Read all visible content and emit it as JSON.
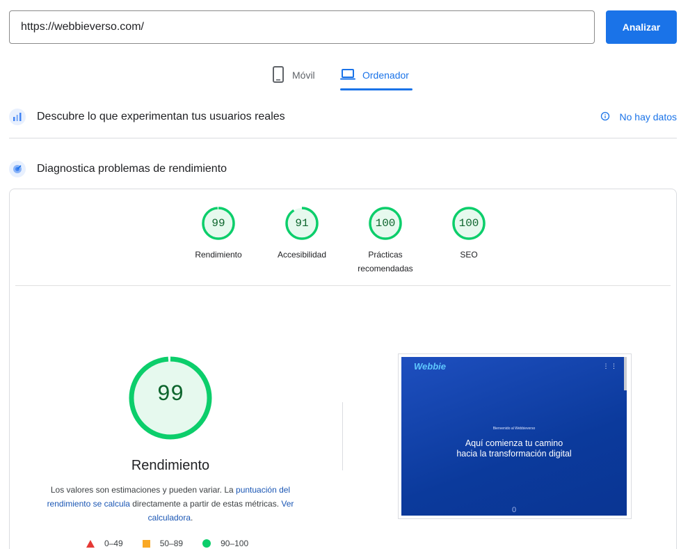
{
  "search": {
    "url_value": "https://webbieverso.com/",
    "analyze_label": "Analizar"
  },
  "tabs": {
    "mobile_label": "Móvil",
    "desktop_label": "Ordenador",
    "active": "desktop"
  },
  "field_data": {
    "title": "Descubre lo que experimentan tus usuarios reales",
    "no_data_label": "No hay datos"
  },
  "diagnostics": {
    "title": "Diagnostica problemas de rendimiento"
  },
  "categories": [
    {
      "score": 99,
      "label": "Rendimiento"
    },
    {
      "score": 91,
      "label": "Accesibilidad"
    },
    {
      "score": 100,
      "label": "Prácticas recomendadas"
    },
    {
      "score": 100,
      "label": "SEO"
    }
  ],
  "performance": {
    "score": 99,
    "title": "Rendimiento",
    "disclaimer_1": "Los valores son estimaciones y pueden variar. La ",
    "link_1": "puntuación del rendimiento se calcula",
    "disclaimer_2": " directamente a partir de estas métricas. ",
    "link_2": "Ver calculadora",
    "disclaimer_3": "."
  },
  "legend": [
    {
      "range": "0–49",
      "shape": "triangle",
      "color": "#e53935"
    },
    {
      "range": "50–89",
      "shape": "square",
      "color": "#f9a825"
    },
    {
      "range": "90–100",
      "shape": "circle",
      "color": "#0cce6b"
    }
  ],
  "screenshot": {
    "logo_text": "Webbie",
    "small_text": "Bienvenido al Webbieverso",
    "headline_1": "Aquí comienza tu camino",
    "headline_2": "hacia la transformación digital",
    "footer_text": "0"
  },
  "colors": {
    "accent": "#1a73e8",
    "pass": "#0cce6b",
    "pass_bg": "#e6f9ee",
    "pass_text": "#0d652d"
  }
}
